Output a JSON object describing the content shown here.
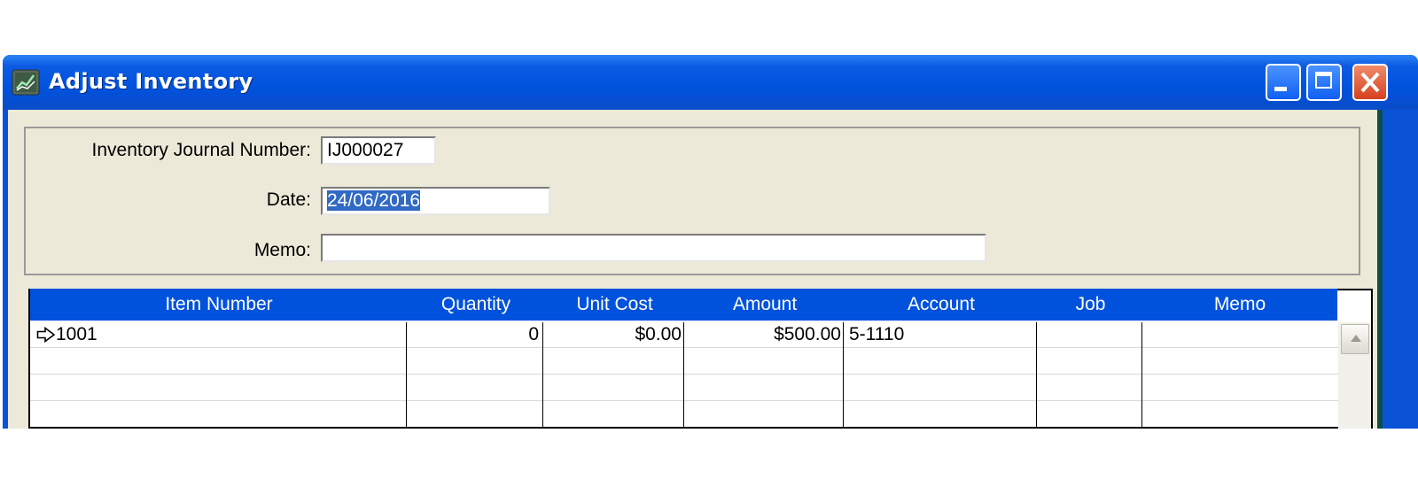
{
  "window": {
    "title": "Adjust Inventory",
    "app_icon": "chart-icon"
  },
  "form": {
    "journal_number_label": "Inventory Journal Number:",
    "journal_number_value": "IJ000027",
    "date_label": "Date:",
    "date_value": "24/06/2016",
    "memo_label": "Memo:",
    "memo_value": ""
  },
  "grid": {
    "columns": [
      "Item Number",
      "Quantity",
      "Unit Cost",
      "Amount",
      "Account",
      "Job",
      "Memo"
    ],
    "rows": [
      {
        "row_marker_icon": "arrow-right-icon",
        "item_number": "1001",
        "quantity": "0",
        "unit_cost": "$0.00",
        "amount": "$500.00",
        "account": "5-1110",
        "job": "",
        "memo": ""
      }
    ]
  },
  "colors": {
    "titlebar": "#0052dd",
    "client": "#ece9d8",
    "selection": "#316ac5",
    "close_button": "#d6401f"
  }
}
